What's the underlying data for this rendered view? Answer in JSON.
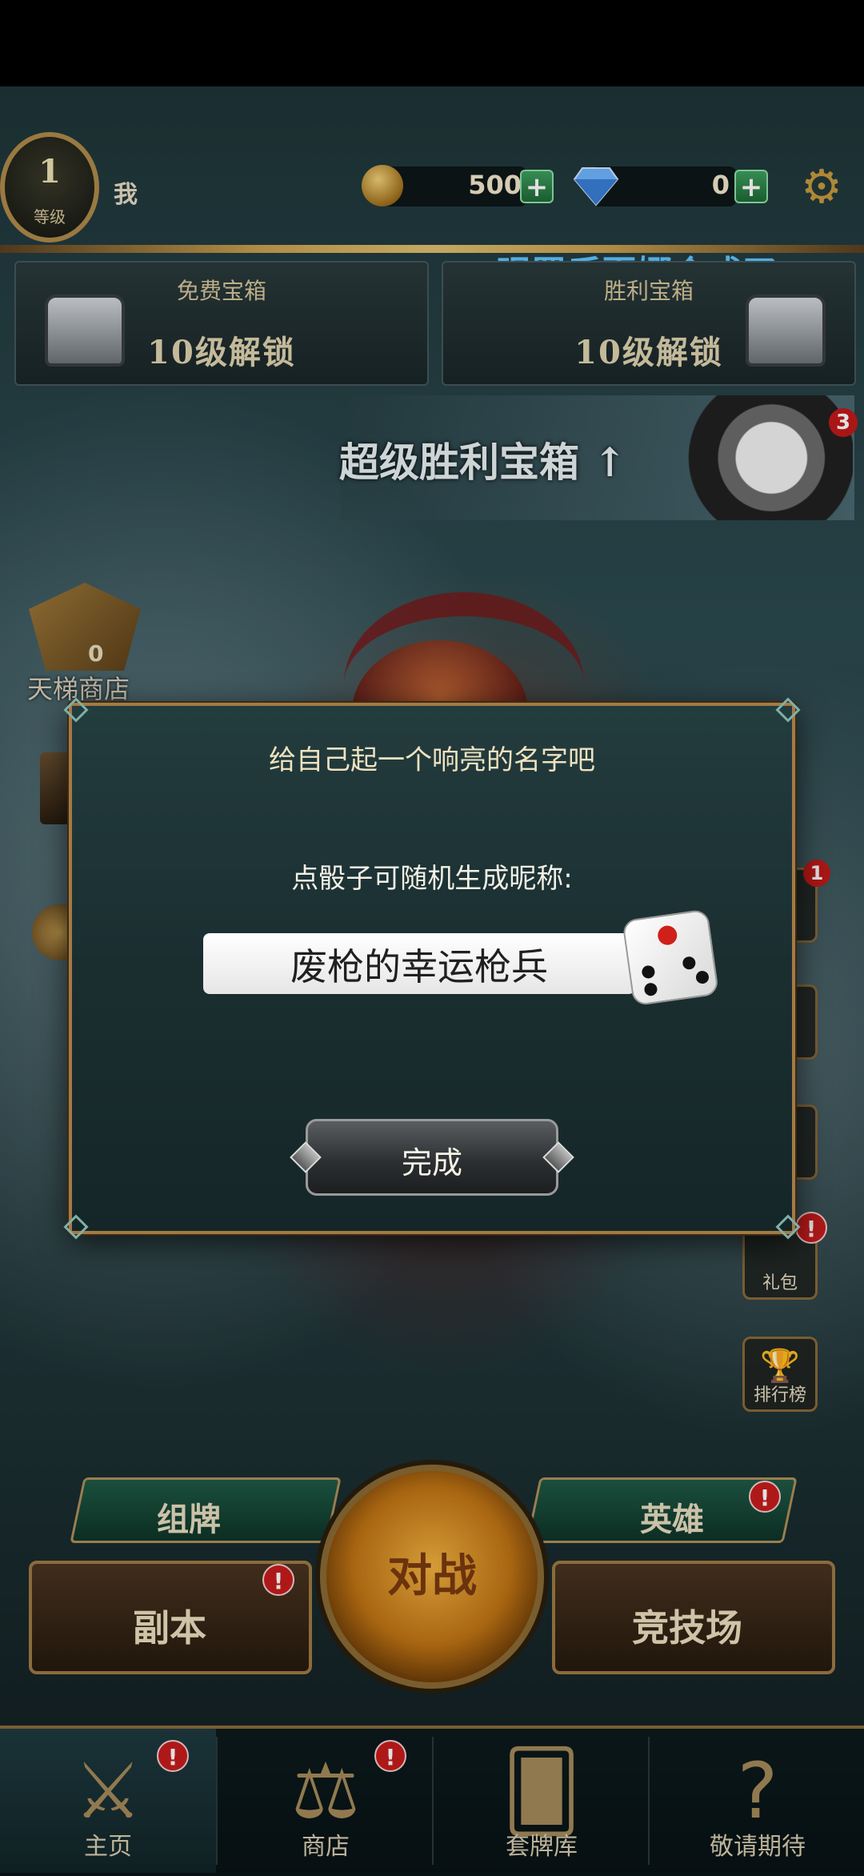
{
  "header": {
    "level": "1",
    "level_label": "等级",
    "player_name": "我",
    "coins": "500",
    "gems": "0",
    "plus": "+",
    "marquee": "眼罩后夏娜合成了"
  },
  "chests": [
    {
      "title": "免费宝箱",
      "lock": "10级解锁"
    },
    {
      "title": "胜利宝箱",
      "lock": "10级解锁"
    }
  ],
  "super_chest": {
    "label": "超级胜利宝箱 ↑",
    "badge": "3"
  },
  "left_side": {
    "ladder_label": "天梯商店",
    "ladder_count": "0"
  },
  "right_side": {
    "badge_top": "1",
    "gift_label": "礼包",
    "rank_label": "排行榜"
  },
  "dialog": {
    "title": "给自己起一个响亮的名字吧",
    "prompt": "点骰子可随机生成昵称:",
    "name_value": "废枪的幸运枪兵",
    "done_label": "完成"
  },
  "actions": {
    "deck": "组牌",
    "heroes": "英雄",
    "dungeon": "副本",
    "arena": "竞技场",
    "battle": "对战",
    "alert": "!"
  },
  "nav": [
    {
      "label": "主页",
      "icon": "swords-icon"
    },
    {
      "label": "商店",
      "icon": "scales-icon"
    },
    {
      "label": "套牌库",
      "icon": "cards-icon"
    },
    {
      "label": "敬请期待",
      "icon": "question-icon"
    }
  ],
  "colors": {
    "accent_gold": "#a57a44",
    "alert_red": "#c81c1c",
    "marquee_blue": "#5fc6ff"
  }
}
